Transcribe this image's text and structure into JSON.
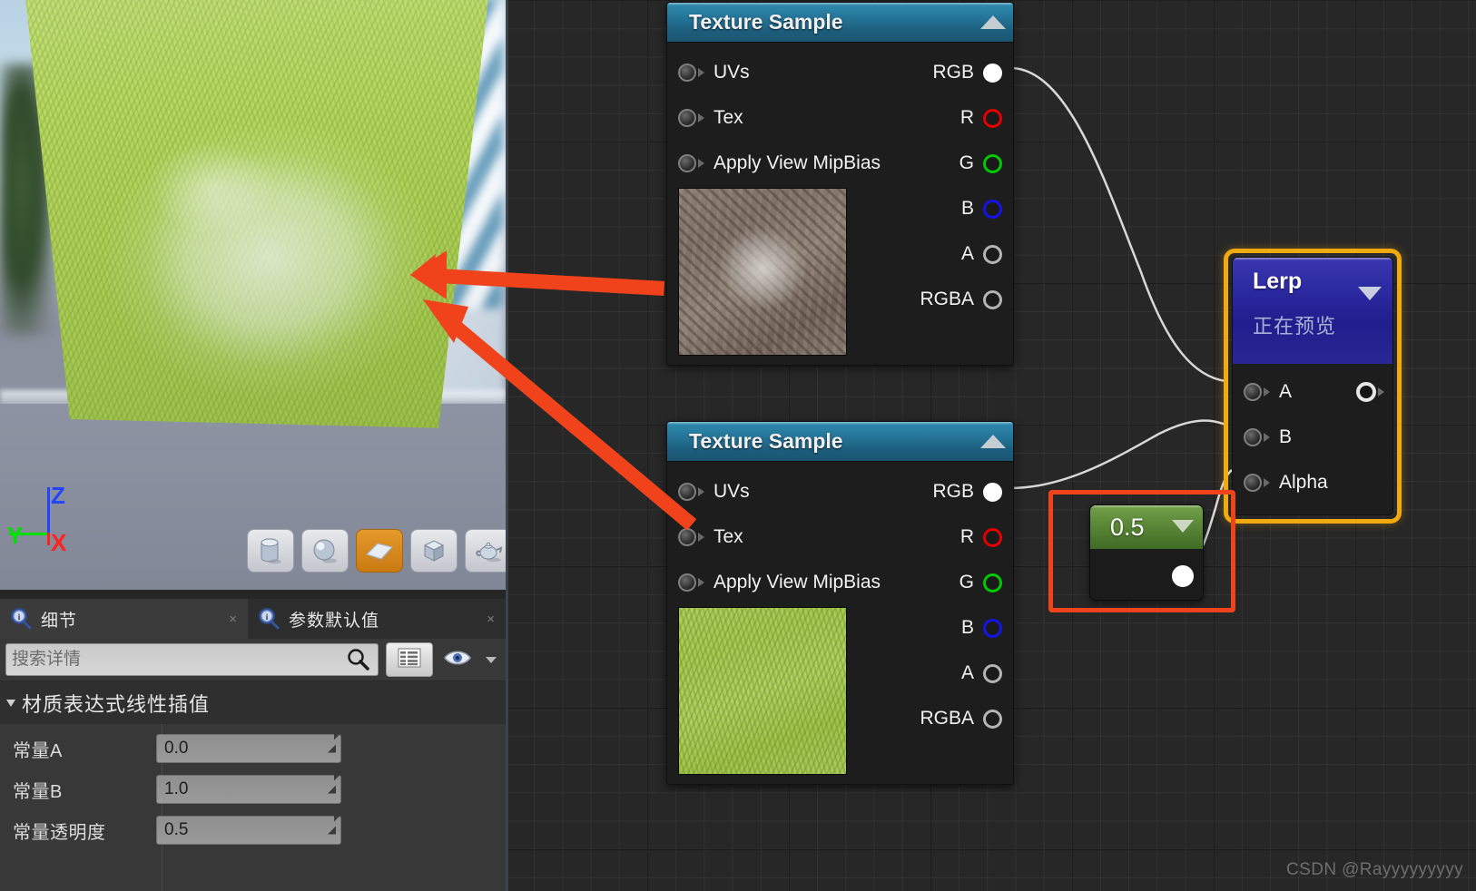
{
  "app": {
    "watermark": "CSDN @Rayyyyyyyyy"
  },
  "viewport": {
    "axis": {
      "x": "X",
      "y": "Y",
      "z": "Z"
    },
    "shape_buttons": [
      {
        "name": "cylinder",
        "label": "Cylinder",
        "active": false
      },
      {
        "name": "sphere",
        "label": "Sphere",
        "active": false
      },
      {
        "name": "plane",
        "label": "Plane",
        "active": true
      },
      {
        "name": "cube",
        "label": "Cube",
        "active": false
      },
      {
        "name": "teapot",
        "label": "Teapot",
        "active": false
      }
    ]
  },
  "details": {
    "tabs": [
      {
        "label": "细节",
        "icon": "details-magnifier-icon",
        "active": false,
        "close": "×"
      },
      {
        "label": "参数默认值",
        "icon": "details-magnifier-icon",
        "active": true,
        "close": "×"
      }
    ],
    "search": {
      "placeholder": "搜索详情",
      "value": "",
      "icon": "search-icon"
    },
    "toolbar": {
      "grid_icon": "grid-view-icon",
      "eye_icon": "visibility-eye-icon",
      "chevron_icon": "chevron-down-icon"
    },
    "category": {
      "label": "材质表达式线性插值",
      "expanded": true
    },
    "properties": [
      {
        "label": "常量A",
        "value": "0.0"
      },
      {
        "label": "常量B",
        "value": "1.0"
      },
      {
        "label": "常量透明度",
        "value": "0.5"
      }
    ]
  },
  "graph": {
    "nodes": [
      {
        "id": "texture-sample-1",
        "title": "Texture Sample",
        "collapse_icon": "collapse-triangle-icon",
        "inputs": [
          "UVs",
          "Tex",
          "Apply View MipBias"
        ],
        "outputs": [
          {
            "label": "RGB",
            "color": "#ffffff",
            "filled": true
          },
          {
            "label": "R",
            "color": "#e40000",
            "filled": false
          },
          {
            "label": "G",
            "color": "#00c900",
            "filled": false
          },
          {
            "label": "B",
            "color": "#1414e6",
            "filled": false
          },
          {
            "label": "A",
            "color": "#b4b4b4",
            "filled": false
          },
          {
            "label": "RGBA",
            "color": "#b4b4b4",
            "filled": false
          }
        ],
        "thumbnail": "rock-texture-preview"
      },
      {
        "id": "texture-sample-2",
        "title": "Texture Sample",
        "collapse_icon": "collapse-triangle-icon",
        "inputs": [
          "UVs",
          "Tex",
          "Apply View MipBias"
        ],
        "outputs": [
          {
            "label": "RGB",
            "color": "#ffffff",
            "filled": true
          },
          {
            "label": "R",
            "color": "#e40000",
            "filled": false
          },
          {
            "label": "G",
            "color": "#00c900",
            "filled": false
          },
          {
            "label": "B",
            "color": "#1414e6",
            "filled": false
          },
          {
            "label": "A",
            "color": "#b4b4b4",
            "filled": false
          },
          {
            "label": "RGBA",
            "color": "#b4b4b4",
            "filled": false
          }
        ],
        "thumbnail": "grass-texture-preview"
      },
      {
        "id": "lerp",
        "title": "Lerp",
        "subtitle": "正在预览",
        "collapse_icon": "collapse-triangle-icon",
        "selected": true,
        "selection_color": "#f0a90f",
        "inputs": [
          "A",
          "B",
          "Alpha"
        ],
        "outputs": [
          {
            "label": "",
            "color": "#e6e6e6",
            "filled": false
          }
        ]
      },
      {
        "id": "constant",
        "value": "0.5",
        "collapse_icon": "collapse-triangle-icon",
        "highlighted": true,
        "highlight_color": "#f0431c",
        "outputs": [
          {
            "label": "",
            "color": "#ffffff",
            "filled": true
          }
        ]
      }
    ],
    "annotations": [
      {
        "type": "arrow",
        "name": "annotation-arrow-top",
        "color": "#f0431c"
      },
      {
        "type": "arrow",
        "name": "annotation-arrow-bottom",
        "color": "#f0431c"
      }
    ]
  }
}
